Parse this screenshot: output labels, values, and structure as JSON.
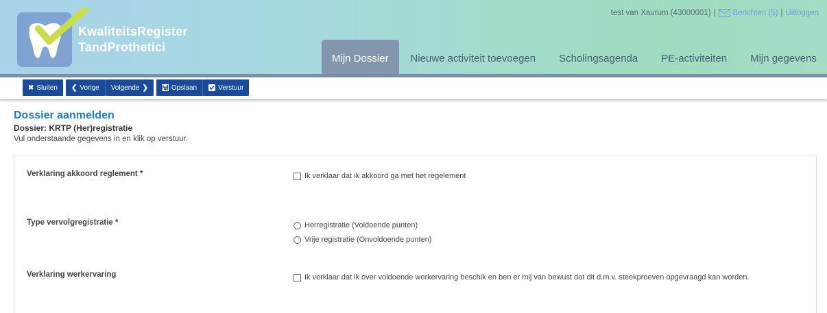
{
  "brand": {
    "line1": "KwaliteitsRegister",
    "line2": "TandProthetici"
  },
  "user_bar": {
    "user": "test van Xaurum (43000001)",
    "separator": "|",
    "messages": "Berichten (5)",
    "logout": "Uitloggen"
  },
  "nav": {
    "items": [
      {
        "label": "Mijn Dossier"
      },
      {
        "label": "Nieuwe activiteit toevoegen"
      },
      {
        "label": "Scholingsagenda"
      },
      {
        "label": "PE-activiteiten"
      },
      {
        "label": "Mijn gegevens"
      }
    ]
  },
  "toolbar": {
    "close": "Sluiten",
    "prev": "Vorige",
    "next": "Volgende",
    "save": "Opslaan",
    "send": "Verstuur"
  },
  "page": {
    "title": "Dossier aanmelden",
    "dossier_label": "Dossier:",
    "dossier_value": "KRTP (Her)registratie",
    "instructions": "Vul onderstaande gegevens in en klik op verstuur."
  },
  "form": {
    "regulation": {
      "label": "Verklaring akkoord reglement  *",
      "option": "Ik verklaar dat ik akkoord ga met het regelement"
    },
    "followup": {
      "label": "Type vervolgregistratie *",
      "options": [
        "Herregistratie (Voldoende punten)",
        "Vrije registratie (Onvoldoende punten)"
      ]
    },
    "experience": {
      "label": "Verklaring werkervaring",
      "option": "Ik verklaar dat ik over voldoende werkervaring beschik en ben er mij van bewust dat dit d.m.v. steekproeven opgevraagd kan worden."
    }
  },
  "colors": {
    "nav_active": "#8496ae",
    "toolbar_button": "#1a4a9a",
    "title": "#1b82c4",
    "logo_box": "#7fa4d3",
    "check_mark": "#c9dc4a"
  }
}
